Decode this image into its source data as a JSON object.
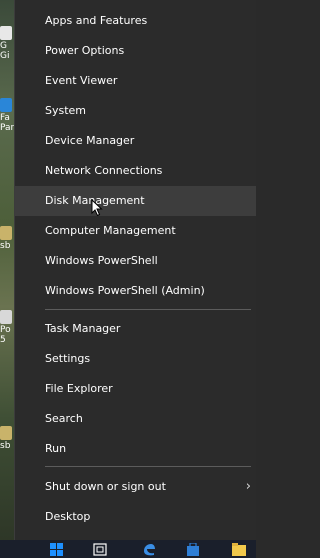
{
  "menu": {
    "group1": [
      "Apps and Features",
      "Power Options",
      "Event Viewer",
      "System",
      "Device Manager",
      "Network Connections",
      "Disk Management",
      "Computer Management",
      "Windows PowerShell",
      "Windows PowerShell (Admin)"
    ],
    "group2": [
      "Task Manager",
      "Settings",
      "File Explorer",
      "Search",
      "Run"
    ],
    "group3": [
      "Shut down or sign out",
      "Desktop"
    ],
    "hovered_item": "Disk Management",
    "submenu_chevron": "›"
  },
  "desktop": {
    "fragments": [
      "G",
      "Gi",
      "Fa",
      "Par",
      "sb",
      "Po",
      "5",
      "sb"
    ]
  },
  "colors": {
    "menu_bg": "#2b2b2b",
    "hover_bg": "#3d3d3d",
    "text": "#ffffff",
    "separator": "#5c5c5c",
    "taskbar_bg": "#1a1f2b",
    "windows_blue": "#1e90ff",
    "edge_blue": "#3a8ee6"
  },
  "taskbar": {
    "icons": [
      "windows-logo-icon",
      "task-view-icon",
      "edge-icon",
      "store-icon",
      "explorer-icon"
    ]
  }
}
